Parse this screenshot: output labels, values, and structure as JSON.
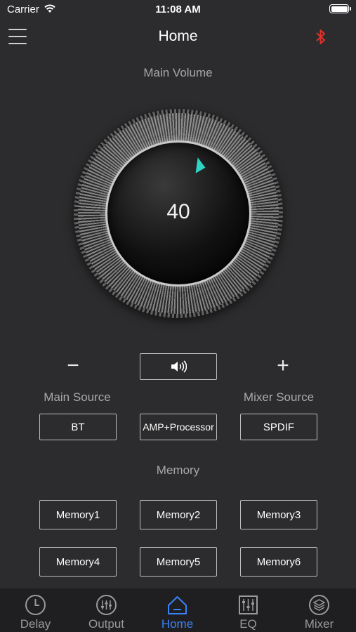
{
  "status_bar": {
    "carrier": "Carrier",
    "time": "11:08 AM"
  },
  "nav": {
    "title": "Home",
    "menu_icon": "hamburger-menu-icon",
    "bluetooth_icon": "bluetooth-icon",
    "bluetooth_color": "#e0322b"
  },
  "volume": {
    "label": "Main Volume",
    "value": "40",
    "accent": "#2fd5c4"
  },
  "controls": {
    "minus": "−",
    "plus": "+",
    "mute_icon": "speaker-icon"
  },
  "sources": {
    "main_label": "Main Source",
    "mixer_label": "Mixer Source",
    "buttons": [
      "BT",
      "AMP+Processor",
      "SPDIF"
    ]
  },
  "memory": {
    "label": "Memory",
    "buttons": [
      "Memory1",
      "Memory2",
      "Memory3",
      "Memory4",
      "Memory5",
      "Memory6"
    ]
  },
  "tabs": [
    {
      "label": "Delay",
      "icon": "clock-icon"
    },
    {
      "label": "Output",
      "icon": "sliders-icon"
    },
    {
      "label": "Home",
      "icon": "home-icon",
      "active": true
    },
    {
      "label": "EQ",
      "icon": "equalizer-icon"
    },
    {
      "label": "Mixer",
      "icon": "layers-icon"
    }
  ],
  "colors": {
    "background": "#2c2c2e",
    "tab_active": "#3a82f7",
    "tab_inactive": "#9a9a9a"
  }
}
